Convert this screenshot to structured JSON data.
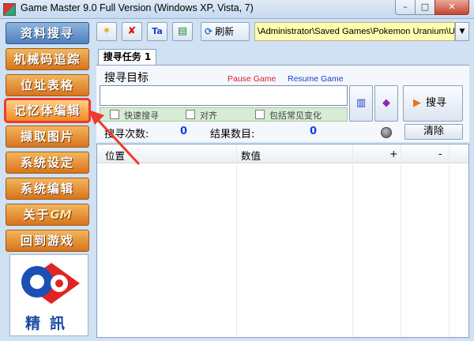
{
  "window": {
    "title": "Game Master 9.0 Full Version (Windows XP, Vista, 7)",
    "minimize": "–",
    "maximize": "□",
    "close": "✕"
  },
  "sidebar": {
    "items": [
      {
        "label": "资料搜寻"
      },
      {
        "label": "机械码追踪"
      },
      {
        "label": "位址表格"
      },
      {
        "label": "记忆体编辑"
      },
      {
        "label": "撷取图片"
      },
      {
        "label": "系统设定"
      },
      {
        "label": "系统编辑"
      },
      {
        "label": "关于"
      },
      {
        "label": "回到游戏"
      }
    ],
    "about_logo_text": "GM",
    "logo_caption": "精訊"
  },
  "toolbar": {
    "refresh_label": "刷新",
    "path": "\\Administrator\\Saved Games\\Pokemon Uranium\\Uranium",
    "dropdown_arrow": "▼"
  },
  "tab": {
    "label": "搜寻任务 1"
  },
  "search": {
    "target_label": "搜寻目标",
    "pause_game": "Pause Game",
    "resume_game": "Resume Game",
    "input_value": "",
    "options": {
      "quick_search": "快速搜寻",
      "align": "对齐",
      "include_common_changes": "包括常见变化"
    },
    "search_button": "搜寻",
    "search_count_label": "搜寻次数:",
    "search_count": "0",
    "result_count_label": "结果数目:",
    "result_count": "0",
    "clear_button": "清除"
  },
  "table": {
    "columns": [
      "位置",
      "数值",
      "+",
      "-"
    ]
  },
  "colors": {
    "nav_orange": "#e0862a",
    "nav_blue": "#5b8bc6",
    "highlight_red": "#ee3a2e",
    "pause_red": "#e02020",
    "resume_blue": "#1c3fd1",
    "path_yellow": "#fffdb0"
  }
}
